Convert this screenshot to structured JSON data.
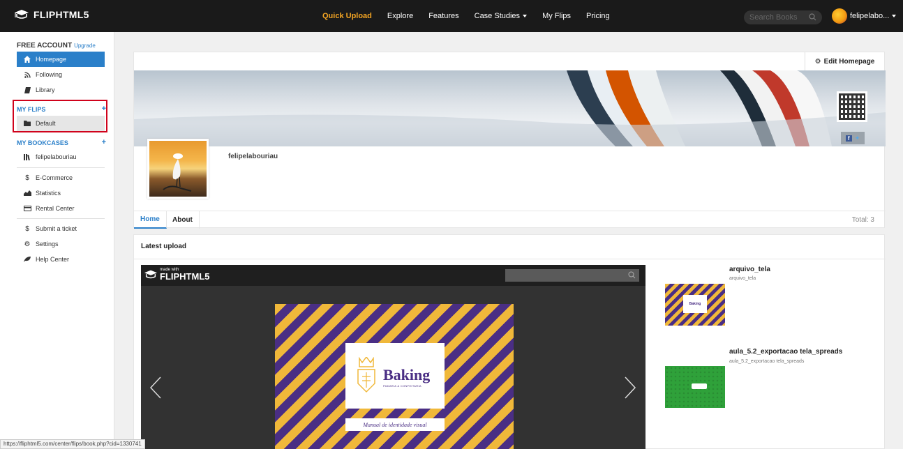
{
  "brand": {
    "name": "FLIPHTML5"
  },
  "nav": {
    "items": [
      "Quick Upload",
      "Explore",
      "Features",
      "Case Studies",
      "My Flips",
      "Pricing"
    ]
  },
  "search": {
    "placeholder": "Search Books"
  },
  "user": {
    "name": "felipelabo..."
  },
  "sidebar": {
    "account_label": "FREE ACCOUNT",
    "upgrade_label": "Upgrade",
    "items": [
      "Homepage",
      "Following",
      "Library"
    ],
    "my_flips_label": "MY FLIPS",
    "flips": [
      "Default"
    ],
    "my_bookcases_label": "MY BOOKCASES",
    "bookcases": [
      "felipelabouriau"
    ],
    "tools": [
      "E-Commerce",
      "Statistics",
      "Rental Center"
    ],
    "support": [
      "Submit a ticket",
      "Settings",
      "Help Center"
    ]
  },
  "profile": {
    "edit_label": "Edit Homepage",
    "username": "felipelabouriau",
    "tabs": [
      "Home",
      "About"
    ],
    "total": "Total: 3"
  },
  "latest": {
    "title": "Latest upload",
    "viewer": {
      "made_with": "made with",
      "brand": "FLIPHTML5",
      "cover_title": "Baking",
      "cover_subtitle": "PADARIA & CONFEITARIA",
      "cover_ribbon": "Manual de identidade visual"
    },
    "items": [
      {
        "title": "arquivo_tela",
        "subtitle": "arquivo_tela",
        "thumb_label": "Baking"
      },
      {
        "title": "aula_5.2_exportacao tela_spreads",
        "subtitle": "aula_5.2_exportacao tela_spreads"
      }
    ]
  },
  "status_url": "https://fliphtml5.com/center/flips/book.php?cid=1330741",
  "colors": {
    "accent": "#2a7fc9",
    "nav_active": "#f5a623",
    "highlight": "#d0021b"
  }
}
